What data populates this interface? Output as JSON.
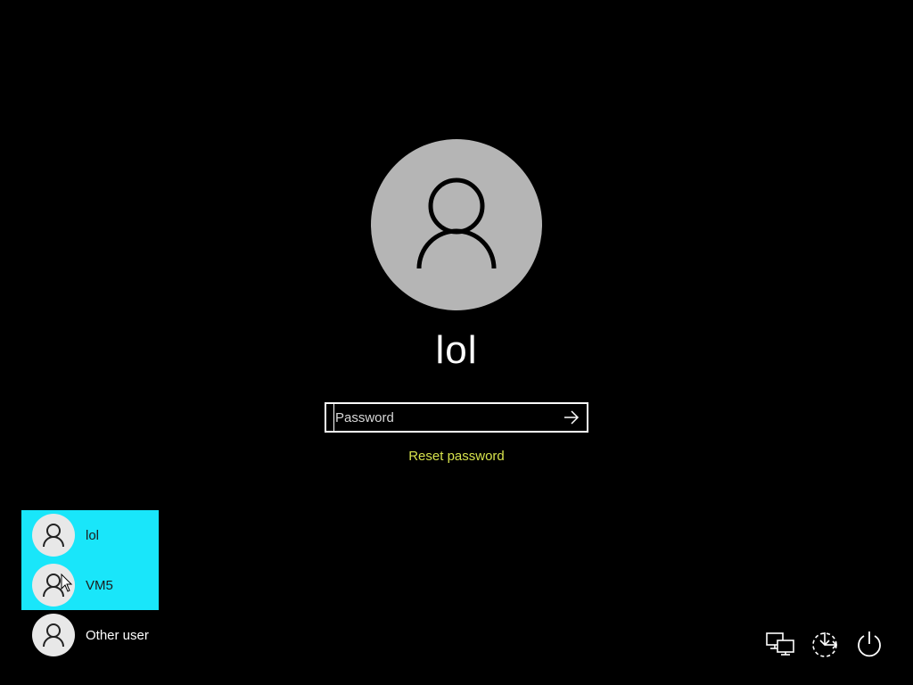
{
  "login": {
    "username": "lol",
    "password_placeholder": "Password",
    "password_value": "",
    "reset_password": "Reset password"
  },
  "users": [
    {
      "name": "lol",
      "highlighted": true
    },
    {
      "name": "VM5",
      "highlighted": true
    },
    {
      "name": "Other user",
      "highlighted": false
    }
  ],
  "icons": {
    "avatar": "user-icon",
    "submit": "arrow-right-icon",
    "network": "network-icon",
    "ease_of_access": "ease-of-access-icon",
    "power": "power-icon"
  },
  "colors": {
    "background": "#000000",
    "avatar_large": "#b5b5b5",
    "user_highlight": "#19e6fa",
    "reset_link": "#d6e24c"
  }
}
